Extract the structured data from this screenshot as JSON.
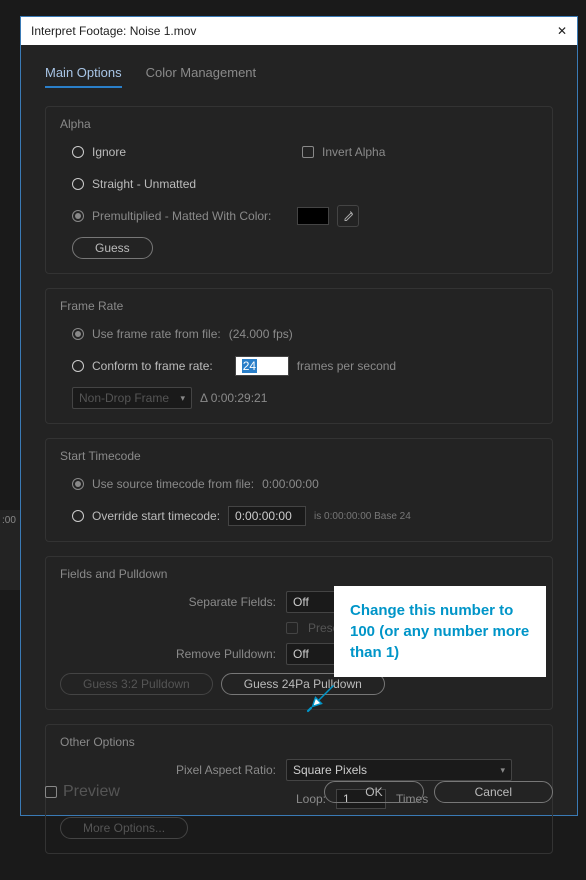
{
  "bg_fragment": ":00",
  "title": "Interpret Footage: Noise 1.mov",
  "tabs": {
    "main": "Main Options",
    "color": "Color Management"
  },
  "alpha": {
    "title": "Alpha",
    "ignore": "Ignore",
    "invert": "Invert Alpha",
    "straight": "Straight - Unmatted",
    "premult": "Premultiplied - Matted With Color:",
    "guess": "Guess"
  },
  "framerate": {
    "title": "Frame Rate",
    "from_file": "Use frame rate from file:",
    "from_file_val": "(24.000 fps)",
    "conform": "Conform to frame rate:",
    "conform_val": "24",
    "fps_label": "frames per second",
    "drop": "Non-Drop Frame",
    "delta": "Δ 0:00:29:21"
  },
  "timecode": {
    "title": "Start Timecode",
    "source": "Use source timecode from file:",
    "source_val": "0:00:00:00",
    "override": "Override start timecode:",
    "override_val": "0:00:00:00",
    "base": "is 0:00:00:00  Base 24"
  },
  "fields": {
    "title": "Fields and Pulldown",
    "separate": "Separate Fields:",
    "separate_val": "Off",
    "preserve": "Preserve Edges (Best Quality Only)",
    "remove": "Remove Pulldown:",
    "remove_val": "Off",
    "guess32": "Guess 3:2 Pulldown",
    "guess24pa": "Guess 24Pa Pulldown"
  },
  "other": {
    "title": "Other Options",
    "par": "Pixel Aspect Ratio:",
    "par_val": "Square Pixels",
    "loop": "Loop:",
    "loop_val": "1",
    "times": "Times",
    "more": "More Options..."
  },
  "footer": {
    "preview": "Preview",
    "ok": "OK",
    "cancel": "Cancel"
  },
  "callout": "Change this number to 100 (or any number more than 1)"
}
